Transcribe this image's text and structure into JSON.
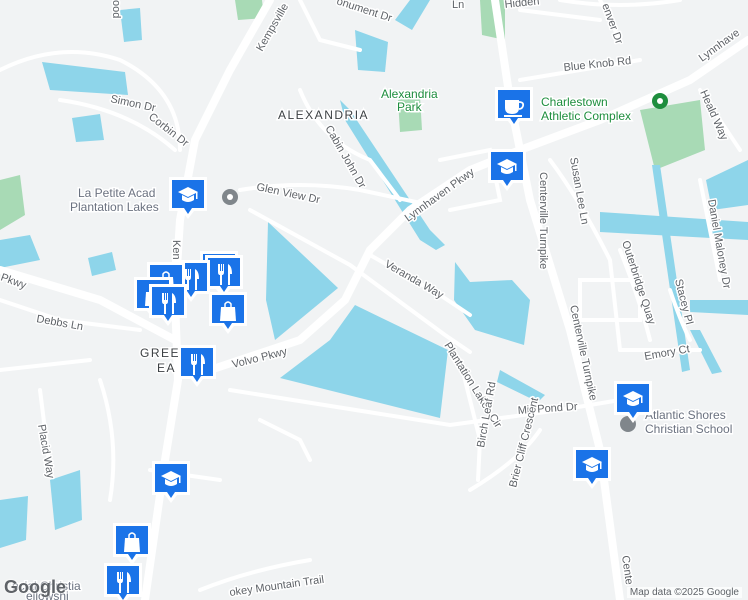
{
  "area": {
    "name": "ALEXANDRIA",
    "greenbrier_1": "GREENB",
    "greenbrier_2": "EA"
  },
  "roads": {
    "kempsville": "Kempsville",
    "kempsville_short": "Ken",
    "simon": "Simon Dr",
    "corbin": "Corbin Dr",
    "cabin_john": "Cabin John Dr",
    "glen_view": "Glen View Dr",
    "lynnhaven_pkwy": "Lynnhaven Pkwy",
    "lynnhaven_ne": "Lynnhave",
    "volvo": "Volvo Pkwy",
    "veranda": "Veranda Way",
    "plantation_lakes": "Plantation Lakes Cir",
    "birch_leaf": "Birch Leaf Rd",
    "mill_pond": "Mill Pond Dr",
    "brier_cliff": "Brier Cliff Crescent",
    "centerville_1": "Centerville Turnpike",
    "centerville_2": "Centerville Turnpike",
    "centerville_3": "Cente",
    "susan_lee": "Susan Lee Ln",
    "blue_knob": "Blue Knob Rd",
    "heald": "Heald Way",
    "daniel_maloney": "Daniel Maloney Dr",
    "outerbridge": "Outerbridge Quay",
    "stacey": "Stacey Pl",
    "emory": "Emory Ct",
    "debbs": "Debbs Ln",
    "placid": "Placid Way",
    "pkwy_w": "Pkwy",
    "monument": "onument Dr",
    "hidden": "Hidden",
    "denver": "enver Dr",
    "top_ln": "Ln",
    "dood": "ood",
    "smokey": "okey Mountain Trail"
  },
  "pois": {
    "alexandria_park_1": "Alexandria",
    "alexandria_park_2": "Park",
    "charlestown_1": "Charlestown",
    "charlestown_2": "Athletic Complex",
    "la_petite_1": "La Petite Acad",
    "la_petite_2": "Plantation Lakes",
    "atlantic_1": "Atlantic Shores",
    "atlantic_2": "Christian School",
    "christian_fellowship_1": "ncial Christia",
    "christian_fellowship_2": "ellowshi"
  },
  "markers": [
    {
      "type": "cafe",
      "icon": "coffee-cup-icon"
    },
    {
      "type": "school",
      "icon": "graduation-cap-icon"
    },
    {
      "type": "school",
      "icon": "graduation-cap-icon"
    },
    {
      "type": "restaurant",
      "icon": "fork-knife-icon"
    },
    {
      "type": "shopping",
      "icon": "shopping-bag-icon"
    },
    {
      "type": "school",
      "icon": "graduation-cap-icon"
    },
    {
      "type": "school",
      "icon": "graduation-cap-icon"
    },
    {
      "type": "school",
      "icon": "graduation-cap-icon"
    }
  ],
  "colors": {
    "water": "#8ed5ea",
    "park": "#a8dab5",
    "road": "#ffffff",
    "marker": "#1a73e8",
    "background": "#f1f3f4"
  },
  "footer": {
    "logo": "Google",
    "attribution": "Map data ©2025 Google"
  }
}
